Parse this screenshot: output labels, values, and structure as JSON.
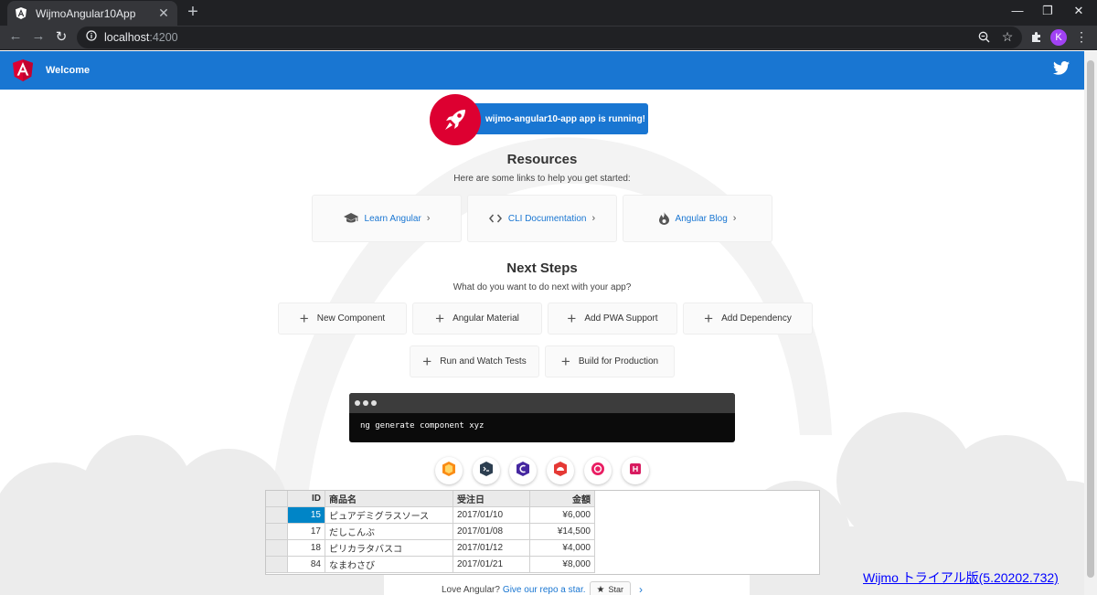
{
  "browser": {
    "tab_title": "WijmoAngular10App",
    "url_host": "localhost",
    "url_port": ":4200",
    "avatar_letter": "K",
    "new_tab_glyph": "+",
    "tab_close_glyph": "✕"
  },
  "toolbar": {
    "title": "Welcome"
  },
  "hero": {
    "running_text": "wijmo-angular10-app app is running!"
  },
  "resources": {
    "heading": "Resources",
    "subtitle": "Here are some links to help you get started:",
    "cards": [
      {
        "label": "Learn Angular",
        "icon": "graduation-cap-icon"
      },
      {
        "label": "CLI Documentation",
        "icon": "code-brackets-icon"
      },
      {
        "label": "Angular Blog",
        "icon": "flame-icon"
      }
    ]
  },
  "next_steps": {
    "heading": "Next Steps",
    "subtitle": "What do you want to do next with your app?",
    "cards": [
      {
        "label": "New Component"
      },
      {
        "label": "Angular Material"
      },
      {
        "label": "Add PWA Support"
      },
      {
        "label": "Add Dependency"
      },
      {
        "label": "Run and Watch Tests"
      },
      {
        "label": "Build for Production"
      }
    ]
  },
  "terminal": {
    "command": "ng generate component xyz"
  },
  "grid": {
    "columns": [
      "ID",
      "商品名",
      "受注日",
      "金額"
    ],
    "rows": [
      [
        "15",
        "ピュアデミグラスソース",
        "2017/01/10",
        "¥6,000"
      ],
      [
        "17",
        "だしこんぶ",
        "2017/01/08",
        "¥14,500"
      ],
      [
        "18",
        "ピリカラタバスコ",
        "2017/01/12",
        "¥4,000"
      ],
      [
        "84",
        "なまわさび",
        "2017/01/21",
        "¥8,000"
      ]
    ]
  },
  "footer": {
    "love_text": "Love Angular?",
    "repo_link": "Give our repo a star.",
    "star_label": "Star"
  },
  "wijmo_notice": "Wijmo トライアル版(5.20202.732)",
  "colors": {
    "angular_red": "#dd0031",
    "primary_blue": "#1976d2",
    "selection_blue": "#0085c7"
  }
}
